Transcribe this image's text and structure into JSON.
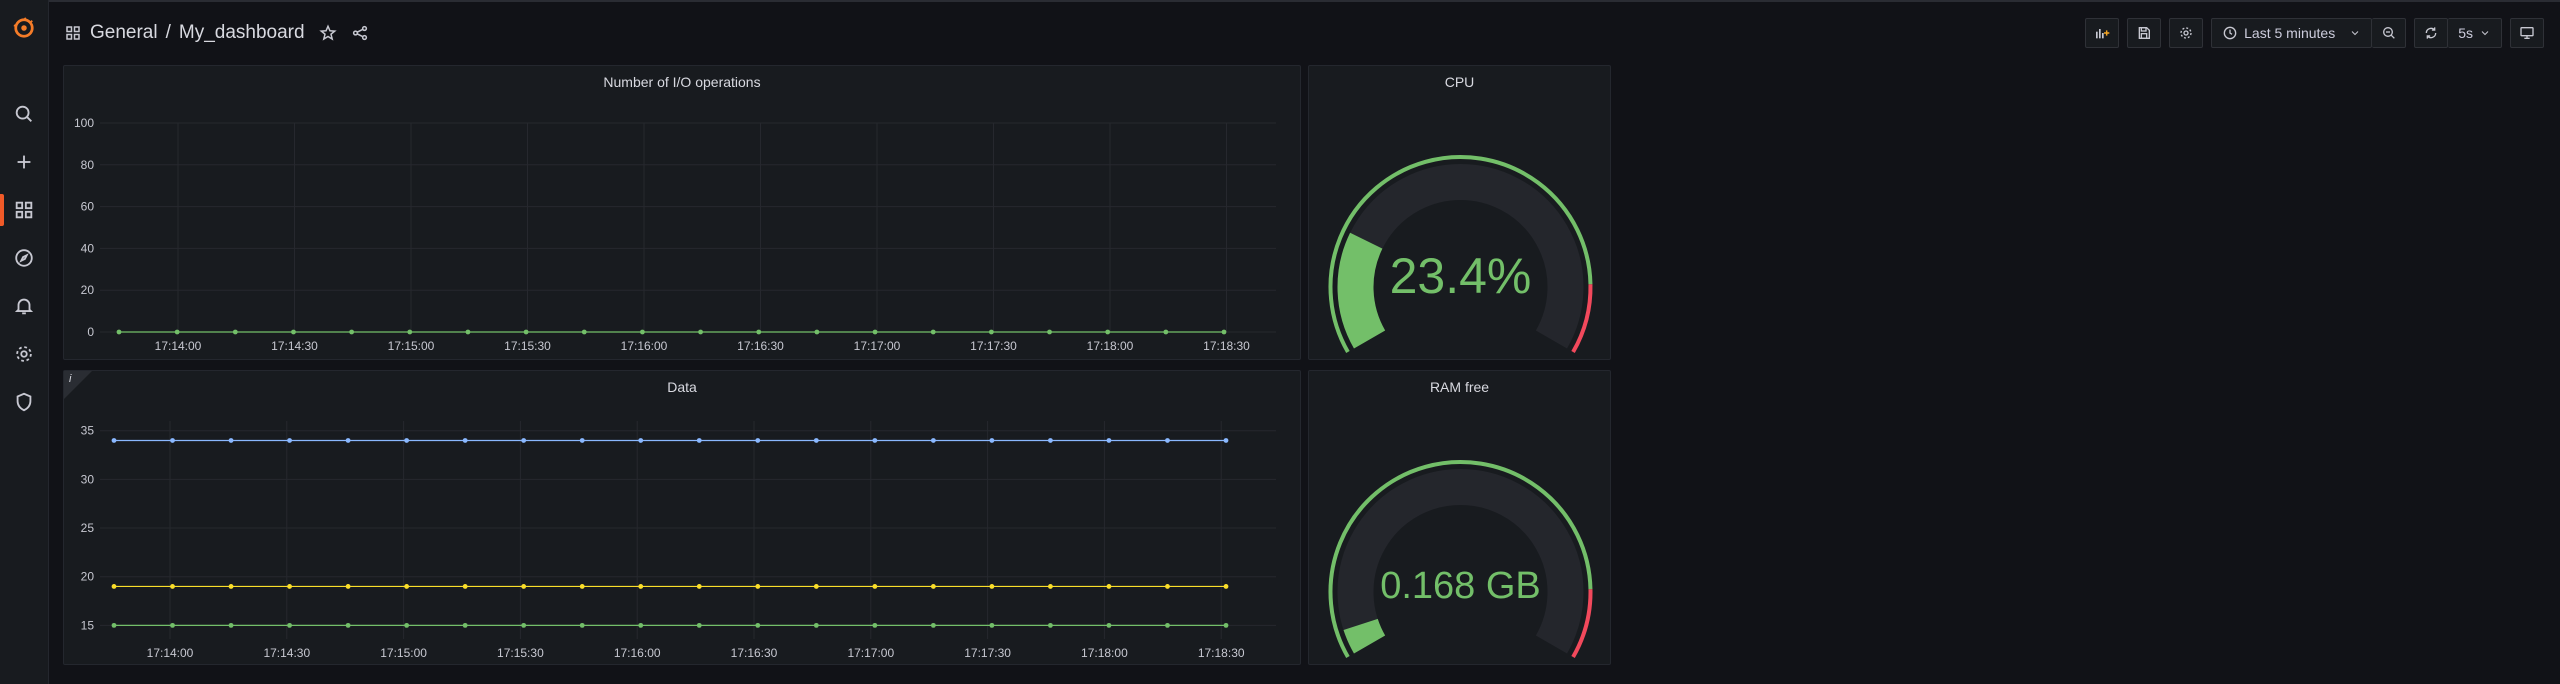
{
  "breadcrumb": {
    "folder": "General",
    "separator": "/",
    "dashboard": "My_dashboard"
  },
  "toolbar": {
    "time_range": "Last 5 minutes",
    "refresh_interval": "5s"
  },
  "sidebar": {
    "items": [
      "grafana-logo",
      "search-icon",
      "plus-icon",
      "dashboards-icon",
      "compass-icon",
      "bell-icon",
      "gear-icon",
      "shield-icon"
    ],
    "active": "dashboards-icon",
    "accent_color": "#f05a28"
  },
  "panels": {
    "io": {
      "title": "Number of I/O operations"
    },
    "cpu": {
      "title": "CPU",
      "value_text": "23.4%",
      "value": 23.4,
      "max": 100,
      "color": "#73bf69",
      "threshold_color": "#f2495c"
    },
    "data": {
      "title": "Data",
      "info": "i"
    },
    "ram": {
      "title": "RAM free",
      "value_text": "0.168 GB",
      "fraction": 0.05,
      "color": "#73bf69",
      "threshold_color": "#f2495c"
    }
  },
  "chart_data": [
    {
      "type": "line",
      "title": "Number of I/O operations",
      "xlabel": "",
      "ylabel": "",
      "ylim": [
        0,
        100
      ],
      "yticks": [
        0,
        20,
        40,
        60,
        80,
        100
      ],
      "xticks": [
        "17:14:00",
        "17:14:30",
        "17:15:00",
        "17:15:30",
        "17:16:00",
        "17:16:30",
        "17:17:00",
        "17:17:30",
        "17:18:00",
        "17:18:30"
      ],
      "points_per_series": 20,
      "series": [
        {
          "color": "#73bf69",
          "values": [
            0,
            0,
            0,
            0,
            0,
            0,
            0,
            0,
            0,
            0,
            0,
            0,
            0,
            0,
            0,
            0,
            0,
            0,
            0,
            0
          ]
        }
      ],
      "grid": true,
      "legend": "none"
    },
    {
      "type": "line",
      "title": "Data",
      "xlabel": "",
      "ylabel": "",
      "ylim": [
        13.6,
        36
      ],
      "yticks": [
        15,
        20,
        25,
        30,
        35
      ],
      "xticks": [
        "17:14:00",
        "17:14:30",
        "17:15:00",
        "17:15:30",
        "17:16:00",
        "17:16:30",
        "17:17:00",
        "17:17:30",
        "17:18:00",
        "17:18:30"
      ],
      "points_per_series": 20,
      "series": [
        {
          "color": "#8ab8ff",
          "values": [
            34,
            34,
            34,
            34,
            34,
            34,
            34,
            34,
            34,
            34,
            34,
            34,
            34,
            34,
            34,
            34,
            34,
            34,
            34,
            34
          ]
        },
        {
          "color": "#fade2a",
          "values": [
            19,
            19,
            19,
            19,
            19,
            19,
            19,
            19,
            19,
            19,
            19,
            19,
            19,
            19,
            19,
            19,
            19,
            19,
            19,
            19
          ]
        },
        {
          "color": "#73bf69",
          "values": [
            15,
            15,
            15,
            15,
            15,
            15,
            15,
            15,
            15,
            15,
            15,
            15,
            15,
            15,
            15,
            15,
            15,
            15,
            15,
            15
          ]
        }
      ],
      "grid": true,
      "legend": "none"
    }
  ]
}
